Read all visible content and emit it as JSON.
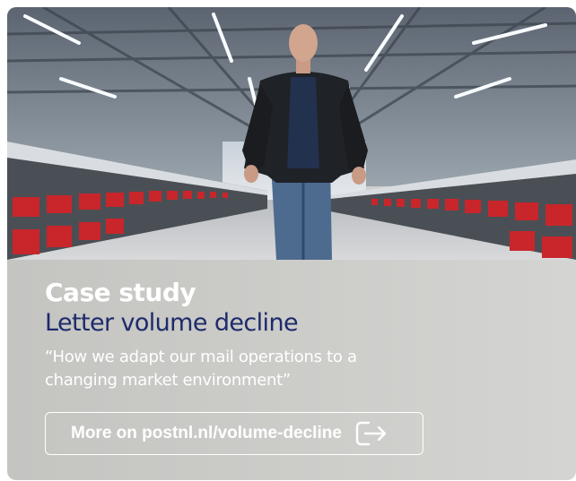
{
  "card": {
    "image": {
      "alt": "",
      "icon": "sorting-hall-photo"
    },
    "eyebrow": "Case study",
    "title": "Letter volume decline",
    "quote": "“How we adapt our mail operations to a changing market environment”",
    "cta": {
      "label": "More on postnl.nl/volume-decline",
      "icon": "external-link-arrow-icon"
    }
  },
  "colors": {
    "title": "#1e2a6b",
    "text": "#ffffff",
    "panel": "#c9c9c6",
    "accent_red": "#c8262b"
  }
}
